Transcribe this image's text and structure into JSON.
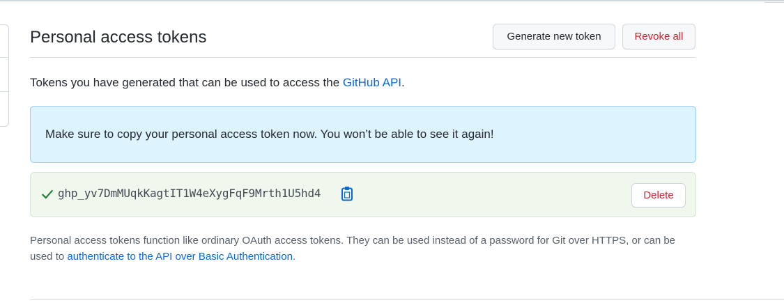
{
  "header": {
    "title": "Personal access tokens",
    "generate_label": "Generate new token",
    "revoke_all_label": "Revoke all"
  },
  "intro": {
    "text_before": "Tokens you have generated that can be used to access the ",
    "link_text": "GitHub API",
    "text_after": "."
  },
  "flash": {
    "message": "Make sure to copy your personal access token now. You won’t be able to see it again!",
    "color": "#ddf4ff"
  },
  "token": {
    "value": "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",
    "delete_label": "Delete",
    "status_icon": "check-icon",
    "copy_icon": "clipboard-icon",
    "success_color": "#1a7f37"
  },
  "footnote": {
    "text_before": "Personal access tokens function like ordinary OAuth access tokens. They can be used instead of a password for Git over HTTPS, or can be used to ",
    "link_text": "authenticate to the API over Basic Authentication",
    "text_after": "."
  },
  "colors": {
    "link": "#0969da",
    "danger": "#cf222e",
    "border": "#d0d7de"
  }
}
